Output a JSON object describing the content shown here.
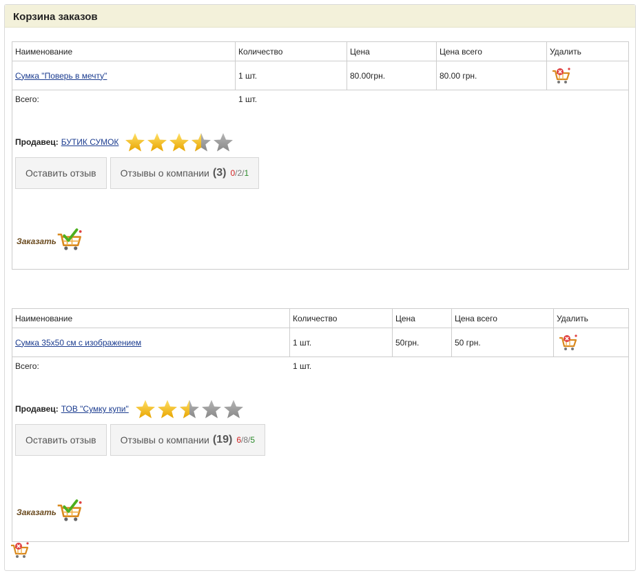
{
  "page": {
    "title": "Корзина заказов"
  },
  "orders": [
    {
      "headers": {
        "name": "Наименование",
        "qty": "Количество",
        "price": "Цена",
        "total": "Цена всего",
        "delete": "Удалить"
      },
      "item": {
        "name": "Сумка \"Поверь в мечту\"",
        "qty": "1 шт.",
        "price": "80.00грн.",
        "total": "80.00 грн."
      },
      "summary": {
        "label": "Всего:",
        "qty": "1 шт."
      },
      "seller": {
        "label": "Продавец:",
        "name": "БУТИК СУМОК",
        "rating": 3.5
      },
      "buttons": {
        "leave_review": "Оставить отзыв",
        "reviews_label": "Отзывы о компании",
        "reviews_count": "(3)",
        "neg": "0",
        "neu": "2",
        "pos": "1"
      },
      "order_label": "Заказать"
    },
    {
      "headers": {
        "name": "Наименование",
        "qty": "Количество",
        "price": "Цена",
        "total": "Цена всего",
        "delete": "Удалить"
      },
      "item": {
        "name": "Сумка 35х50 см с изображением",
        "qty": "1 шт.",
        "price": "50грн.",
        "total": "50 грн."
      },
      "summary": {
        "label": "Всего:",
        "qty": "1 шт."
      },
      "seller": {
        "label": "Продавец:",
        "name": "ТОВ \"Сумку купи\"",
        "rating": 2.5
      },
      "buttons": {
        "leave_review": "Оставить отзыв",
        "reviews_label": "Отзывы о компании",
        "reviews_count": "(19)",
        "neg": "6",
        "neu": "8",
        "pos": "5"
      },
      "order_label": "Заказать"
    }
  ],
  "icons": {
    "delete": "cart-delete-icon",
    "order": "cart-check-icon",
    "star": "star-icon"
  },
  "colors": {
    "header_bg": "#f3f1da",
    "link": "#1a3b8f",
    "star_gold": "#f5b400",
    "star_gray": "#9a9a9a",
    "neg": "#d02020",
    "pos": "#2a8a2a"
  }
}
